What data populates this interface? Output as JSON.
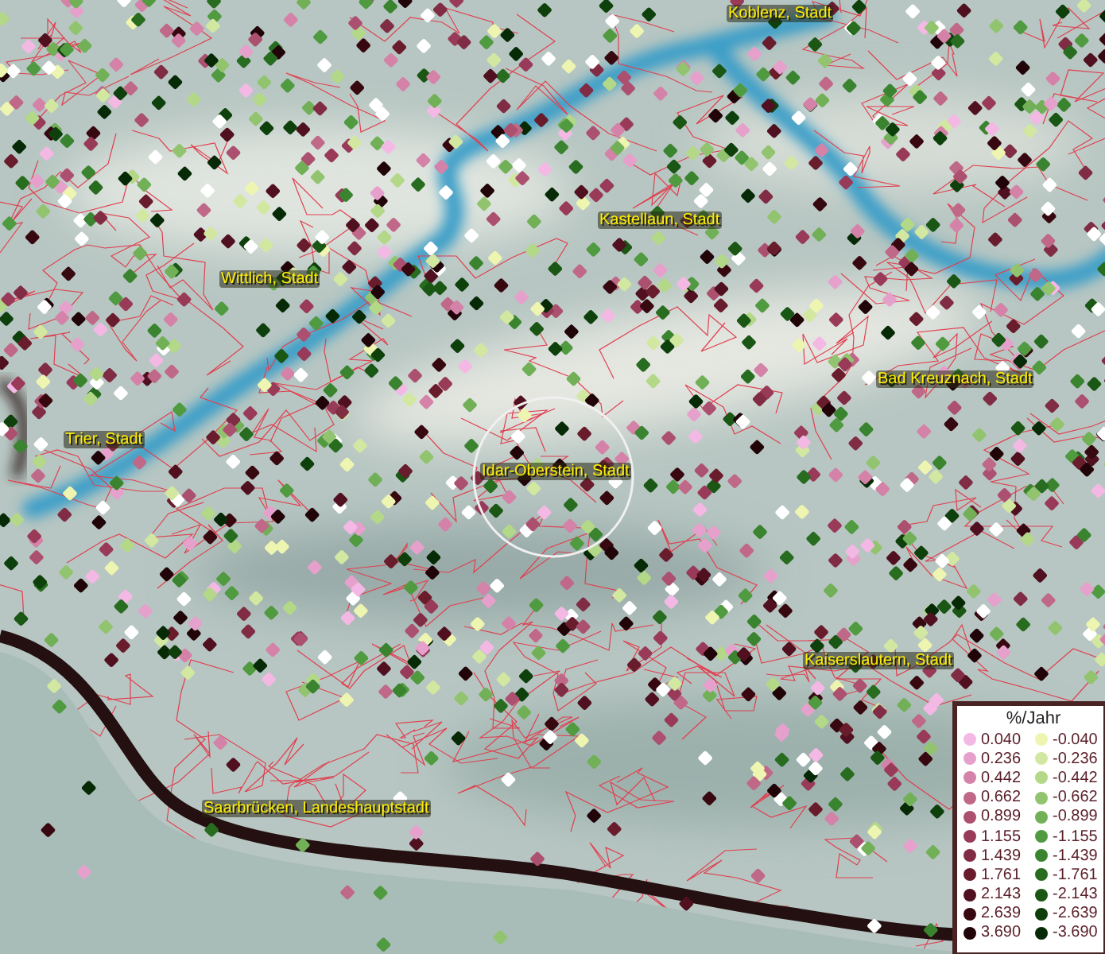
{
  "map": {
    "places": [
      {
        "name": "Koblenz, Stadt"
      },
      {
        "name": "Kastellaun, Stadt"
      },
      {
        "name": "Wittlich, Stadt"
      },
      {
        "name": "Bad Kreuznach, Stadt"
      },
      {
        "name": "Trier, Stadt"
      },
      {
        "name": "Idar-Oberstein, Stadt"
      },
      {
        "name": "Kaiserslautern, Stadt"
      },
      {
        "name": "Saarbrücken, Landeshauptstadt"
      }
    ]
  },
  "legend": {
    "title": "%/Jahr",
    "positive": [
      {
        "value": "0.040",
        "color": "#f4b8e4"
      },
      {
        "value": "0.236",
        "color": "#e6a0cc"
      },
      {
        "value": "0.442",
        "color": "#d482a8"
      },
      {
        "value": "0.662",
        "color": "#c06888"
      },
      {
        "value": "0.899",
        "color": "#ac5070"
      },
      {
        "value": "1.155",
        "color": "#983a58"
      },
      {
        "value": "1.439",
        "color": "#802c44"
      },
      {
        "value": "1.761",
        "color": "#681c2c"
      },
      {
        "value": "2.143",
        "color": "#501020"
      },
      {
        "value": "2.639",
        "color": "#380810"
      },
      {
        "value": "3.690",
        "color": "#200408"
      }
    ],
    "negative": [
      {
        "value": "-0.040",
        "color": "#eef5b0"
      },
      {
        "value": "-0.236",
        "color": "#d2e8a0"
      },
      {
        "value": "-0.442",
        "color": "#b2d888"
      },
      {
        "value": "-0.662",
        "color": "#92c470"
      },
      {
        "value": "-0.899",
        "color": "#72b058"
      },
      {
        "value": "-1.155",
        "color": "#509a40"
      },
      {
        "value": "-1.439",
        "color": "#3a8430"
      },
      {
        "value": "-1.761",
        "color": "#286c20"
      },
      {
        "value": "-2.143",
        "color": "#1a5614"
      },
      {
        "value": "-2.639",
        "color": "#0e400c"
      },
      {
        "value": "-3.690",
        "color": "#062a06"
      }
    ]
  }
}
